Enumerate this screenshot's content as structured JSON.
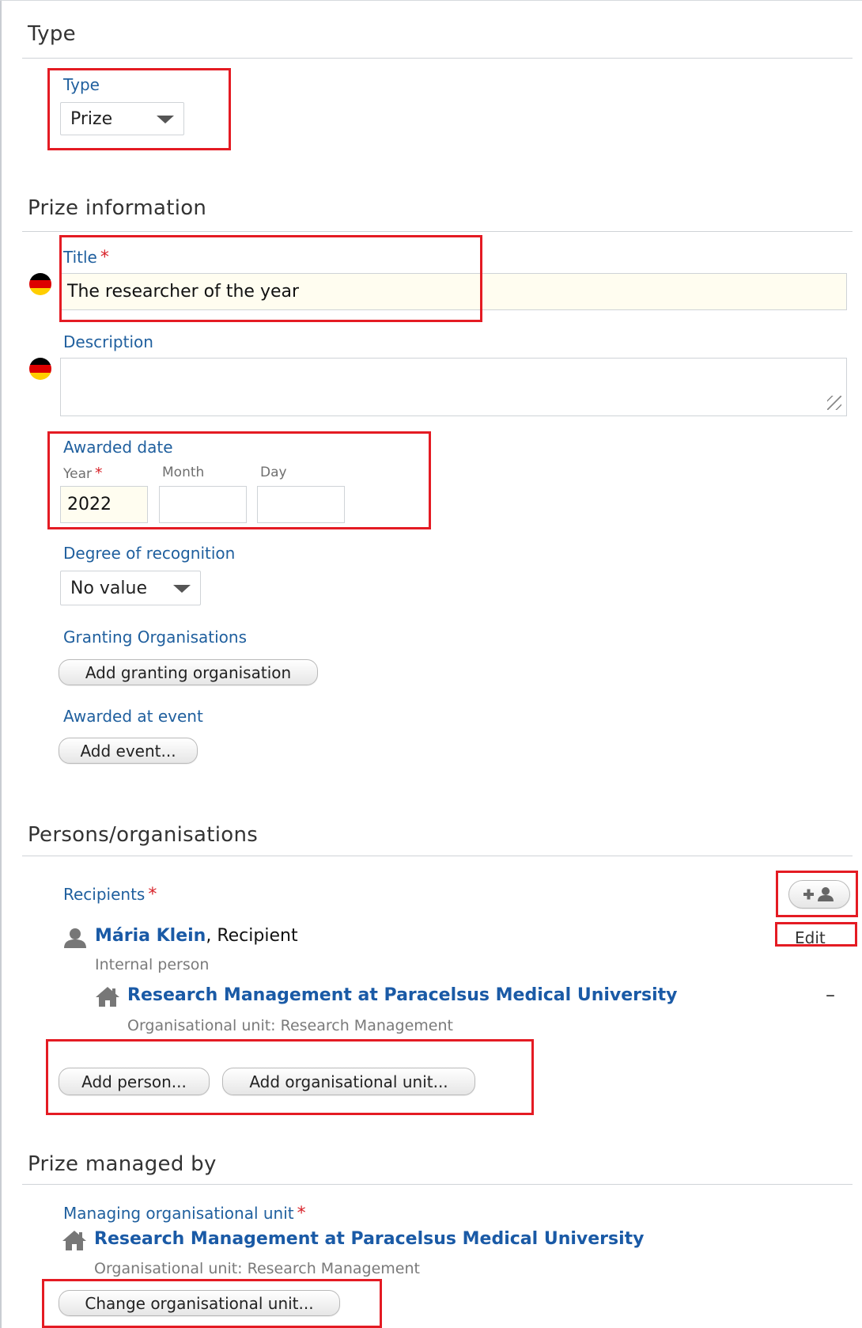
{
  "sections": {
    "type": {
      "title": "Type"
    },
    "prize_information": {
      "title": "Prize information"
    },
    "persons_organisations": {
      "title": "Persons/organisations"
    },
    "prize_managed_by": {
      "title": "Prize managed by"
    }
  },
  "type_field": {
    "label": "Type",
    "value": "Prize"
  },
  "title_field": {
    "label": "Title",
    "value": "The researcher of the year",
    "required_mark": "*"
  },
  "description_field": {
    "label": "Description",
    "value": ""
  },
  "awarded_date": {
    "label": "Awarded date",
    "year_label": "Year",
    "month_label": "Month",
    "day_label": "Day",
    "year_value": "2022",
    "month_value": "",
    "day_value": "",
    "required_mark": "*"
  },
  "degree_of_recognition": {
    "label": "Degree of recognition",
    "value": "No value"
  },
  "granting_organisations": {
    "label": "Granting Organisations",
    "button": "Add granting organisation"
  },
  "awarded_at_event": {
    "label": "Awarded at event",
    "button": "Add event..."
  },
  "recipients": {
    "label": "Recipients",
    "required_mark": "*",
    "person": {
      "name": "Mária Klein",
      "role": ", Recipient",
      "type": "Internal person",
      "edit_label": "Edit"
    },
    "organisation": {
      "name": "Research Management at Paracelsus Medical University",
      "detail": "Organisational unit: Research Management",
      "remove_label": "–"
    },
    "add_person_button": "Add person...",
    "add_org_button": "Add organisational unit..."
  },
  "managing_unit": {
    "label": "Managing organisational unit",
    "required_mark": "*",
    "name": "Research Management at Paracelsus Medical University",
    "detail": "Organisational unit: Research Management",
    "change_button": "Change organisational unit..."
  },
  "icons": {
    "flag": "german-flag-icon",
    "person": "person-icon",
    "house": "house-icon",
    "add_person": "add-person-icon"
  },
  "colors": {
    "label_blue": "#1f5f9e",
    "link_blue": "#1a5aa6",
    "required_red": "#d8232a",
    "highlight_red": "#e41b23",
    "filled_input_bg": "#fffdf0"
  }
}
